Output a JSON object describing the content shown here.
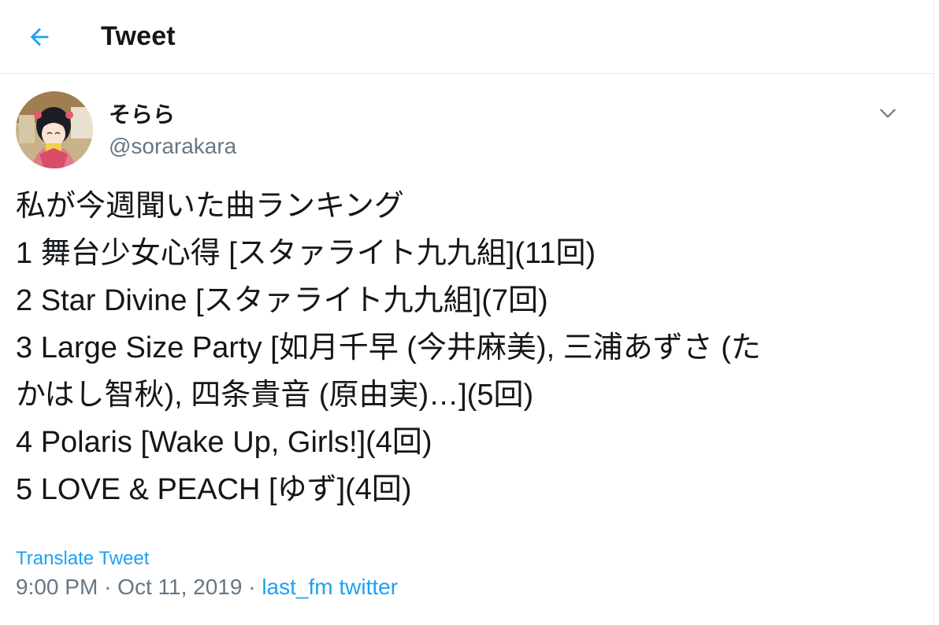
{
  "header": {
    "title": "Tweet"
  },
  "author": {
    "display_name": "そらら",
    "handle": "@sorarakara"
  },
  "tweet": {
    "lines": [
      "私が今週聞いた曲ランキング",
      "1 舞台少女心得 [スタァライト九九組](11回)",
      "2 Star Divine [スタァライト九九組](7回)",
      "3 Large Size Party [如月千早 (今井麻美), 三浦あずさ (た",
      "かはし智秋), 四条貴音 (原由実)…](5回)",
      "4 Polaris [Wake Up, Girls!](4回)",
      "5 LOVE & PEACH [ゆず](4回)"
    ]
  },
  "translate_label": "Translate Tweet",
  "meta": {
    "time": "9:00 PM",
    "separator": "·",
    "date": "Oct 11, 2019",
    "source": "last_fm twitter"
  },
  "colors": {
    "accent": "#1da1f2",
    "secondary_text": "#657786",
    "border": "#e6ecf0"
  },
  "icons": {
    "back": "back-arrow-icon",
    "caret": "chevron-down-icon"
  }
}
